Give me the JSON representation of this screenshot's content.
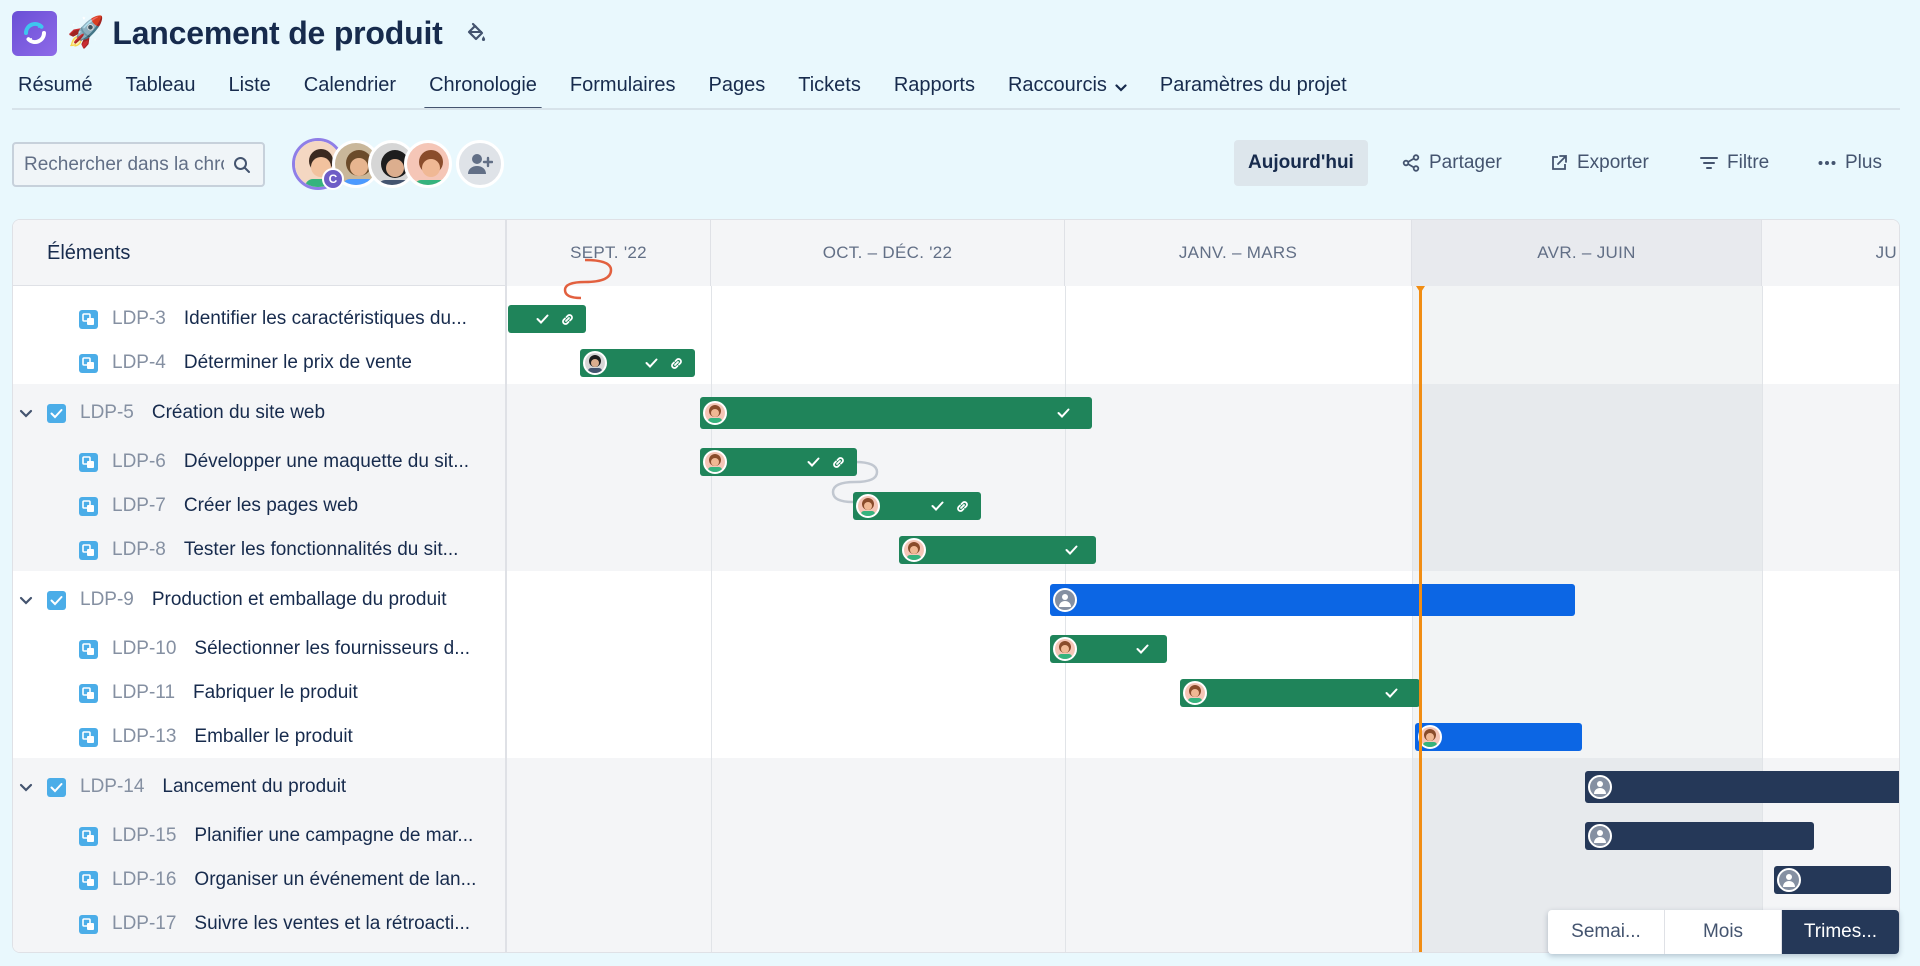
{
  "project": {
    "emoji": "🚀",
    "title": "Lancement de produit",
    "logo_icon": "refresh-logo-icon",
    "theme_icon": "paint-bucket-icon"
  },
  "tabs": [
    {
      "label": "Résumé"
    },
    {
      "label": "Tableau"
    },
    {
      "label": "Liste"
    },
    {
      "label": "Calendrier"
    },
    {
      "label": "Chronologie",
      "active": true
    },
    {
      "label": "Formulaires"
    },
    {
      "label": "Pages"
    },
    {
      "label": "Tickets"
    },
    {
      "label": "Rapports"
    },
    {
      "label": "Raccourcis"
    },
    {
      "label": "Paramètres du projet"
    }
  ],
  "toolbar": {
    "search_placeholder": "Rechercher dans la chronologie",
    "avatar_badge": "C",
    "today": "Aujourd'hui",
    "share": "Partager",
    "export": "Exporter",
    "filter": "Filtre",
    "more": "Plus"
  },
  "timeline": {
    "items_header": "Éléments",
    "periods": [
      "SEPT. '22",
      "OCT. – DÉC. '22",
      "JANV. – MARS",
      "AVR. – JUIN",
      "JU"
    ],
    "current_period": "AVR. – JUIN",
    "rows": [
      {
        "key": "LDP-3",
        "summary": "Identifier les caractéristiques du...",
        "type": "subtask",
        "status": "done"
      },
      {
        "key": "LDP-4",
        "summary": "Déterminer le prix de vente",
        "type": "subtask",
        "status": "done"
      },
      {
        "key": "LDP-5",
        "summary": "Création du site web",
        "type": "epic",
        "status": "done"
      },
      {
        "key": "LDP-6",
        "summary": "Développer une maquette du sit...",
        "type": "subtask",
        "status": "done"
      },
      {
        "key": "LDP-7",
        "summary": "Créer les pages web",
        "type": "subtask",
        "status": "done"
      },
      {
        "key": "LDP-8",
        "summary": "Tester les fonctionnalités du sit...",
        "type": "subtask",
        "status": "done"
      },
      {
        "key": "LDP-9",
        "summary": "Production et emballage du produit",
        "type": "epic",
        "status": "in-progress"
      },
      {
        "key": "LDP-10",
        "summary": "Sélectionner les fournisseurs d...",
        "type": "subtask",
        "status": "done"
      },
      {
        "key": "LDP-11",
        "summary": "Fabriquer le produit",
        "type": "subtask",
        "status": "done"
      },
      {
        "key": "LDP-13",
        "summary": "Emballer le produit",
        "type": "subtask",
        "status": "in-progress"
      },
      {
        "key": "LDP-14",
        "summary": "Lancement du produit",
        "type": "epic",
        "status": "todo"
      },
      {
        "key": "LDP-15",
        "summary": "Planifier une campagne de mar...",
        "type": "subtask",
        "status": "todo"
      },
      {
        "key": "LDP-16",
        "summary": "Organiser un événement de lan...",
        "type": "subtask",
        "status": "todo"
      },
      {
        "key": "LDP-17",
        "summary": "Suivre les ventes et la rétroacti...",
        "type": "subtask",
        "status": "todo"
      }
    ],
    "colors": {
      "done": "#1f845a",
      "in_progress": "#0c66e4",
      "todo": "#253858",
      "today": "#f18d13"
    }
  },
  "zoom": {
    "options": [
      "Semai...",
      "Mois",
      "Trimes..."
    ],
    "selected": "Trimes..."
  }
}
